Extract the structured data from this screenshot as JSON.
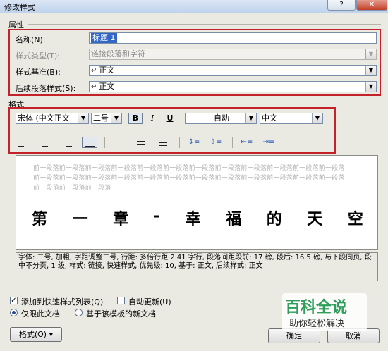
{
  "window": {
    "title": "修改样式",
    "help_label": "?",
    "close_label": "✕"
  },
  "properties": {
    "group_label": "属性",
    "name_label": "名称(N):",
    "name_value": "标题 1",
    "style_type_label": "样式类型(T):",
    "style_type_value": "链接段落和字符",
    "based_on_label": "样式基准(B):",
    "based_on_value": "正文",
    "following_label": "后续段落样式(S):",
    "following_value": "正文"
  },
  "format": {
    "group_label": "格式",
    "font_value": "宋体 (中文正文",
    "size_value": "二号",
    "bold_label": "B",
    "italic_label": "I",
    "underline_label": "U",
    "color_value": "自动",
    "language_value": "中文"
  },
  "preview": {
    "prev_line_1": "前一段落前一段落前一段落前一段落前一段落前一段落前一段落前一段落前一段落前一段落前一段落前一段落",
    "prev_line_2": "前一段落前一段落前一段落前一段落前一段落前一段落前一段落前一段落前一段落前一段落前一段落前一段落",
    "prev_line_3": "前一段落前一段落前一段落",
    "heading_chars": [
      "第",
      "一",
      "章",
      "-",
      "幸",
      "福",
      "的",
      "天",
      "空"
    ]
  },
  "description": "字体: 二号, 加粗, 字距调整二号, 行距: 多倍行距 2.41 字行, 段落间距段前: 17 磅, 段后: 16.5 磅, 与下段同页, 段中不分页, 1 级, 样式: 链接, 快速样式, 优先级: 10, 基于: 正文, 后续样式: 正文",
  "options": {
    "add_quick_label": "添加到快速样式列表(Q)",
    "add_quick_checked": true,
    "auto_update_label": "自动更新(U)",
    "auto_update_checked": false,
    "only_doc_label": "仅限此文档",
    "new_docs_label": "基于该模板的新文档"
  },
  "buttons": {
    "format_label": "格式(O) ▾",
    "ok_label": "确定",
    "cancel_label": "取消"
  },
  "watermark": {
    "title": "百科全说",
    "subtitle": "助你轻松解决"
  },
  "colors": {
    "highlight_box": "#c4222a",
    "selection": "#3166c6",
    "watermark_green": "#2e9e5a"
  }
}
